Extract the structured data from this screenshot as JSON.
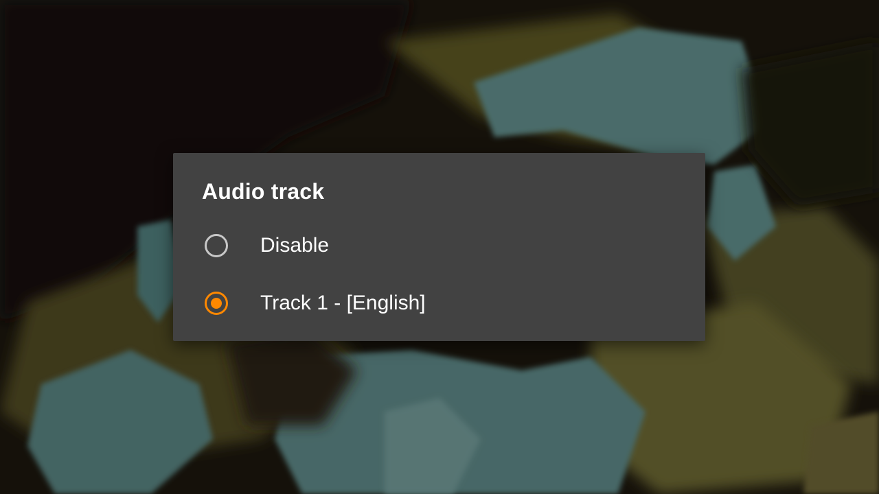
{
  "dialog": {
    "title": "Audio track",
    "accent_color": "#ff8800",
    "options": [
      {
        "label": "Disable",
        "selected": false
      },
      {
        "label": "Track 1 - [English]",
        "selected": true
      }
    ]
  }
}
